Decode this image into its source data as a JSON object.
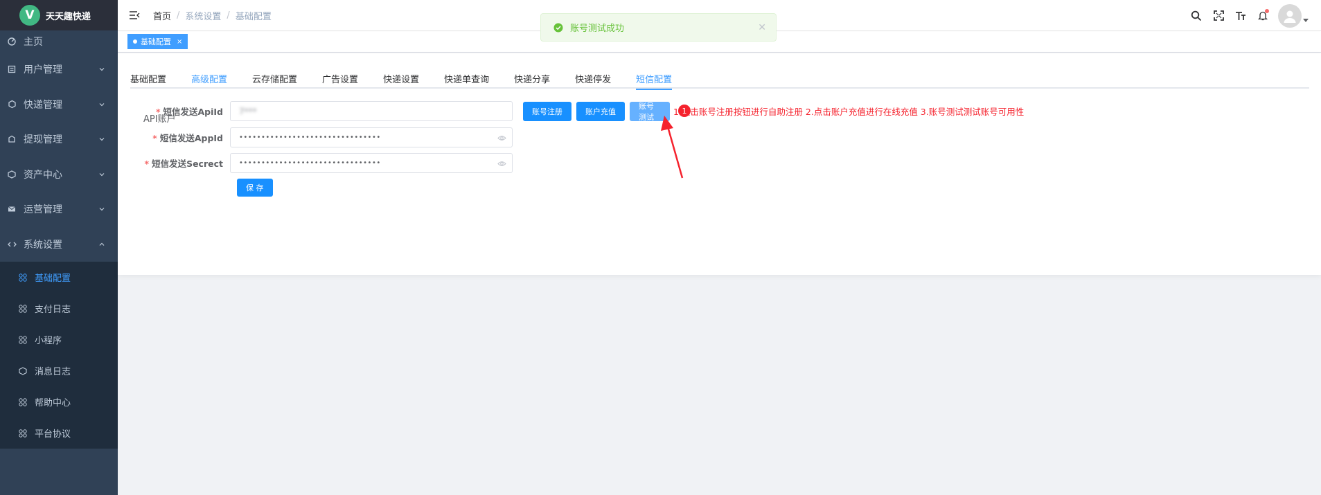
{
  "app": {
    "name": "天天趣快递",
    "logo_letter": "V"
  },
  "sidebar": {
    "items": [
      {
        "label": "主页",
        "icon": "dashboard-icon"
      },
      {
        "label": "用户管理",
        "icon": "user-icon"
      },
      {
        "label": "快递管理",
        "icon": "express-icon"
      },
      {
        "label": "提现管理",
        "icon": "withdraw-icon"
      },
      {
        "label": "资产中心",
        "icon": "asset-icon"
      },
      {
        "label": "运营管理",
        "icon": "mail-icon"
      },
      {
        "label": "系统设置",
        "icon": "code-icon"
      }
    ],
    "submenu": [
      {
        "label": "基础配置",
        "active": true
      },
      {
        "label": "支付日志"
      },
      {
        "label": "小程序"
      },
      {
        "label": "消息日志"
      },
      {
        "label": "帮助中心"
      },
      {
        "label": "平台协议"
      }
    ]
  },
  "breadcrumb": [
    "首页",
    "系统设置",
    "基础配置"
  ],
  "tags": {
    "active": "基础配置"
  },
  "toast": {
    "message": "账号测试成功"
  },
  "tabs": [
    "基础配置",
    "高级配置",
    "云存储配置",
    "广告设置",
    "快递设置",
    "快递单查询",
    "快递分享",
    "快递停发",
    "短信配置"
  ],
  "form": {
    "section_title": "API账户",
    "apiid_label": "短信发送ApiId",
    "apiid_value": "7***",
    "appid_label": "短信发送AppId",
    "appid_value": "••••••••••••••••••••••••••••••••",
    "secret_label": "短信发送Secrect",
    "secret_value": "••••••••••••••••••••••••••••••••",
    "register_btn": "账号注册",
    "recharge_btn": "账户充值",
    "test_btn": "账号测试",
    "hint": "1.点击账号注册按钮进行自助注册 2.点击账户充值进行在线充值 3.账号测试测试账号可用性",
    "save_btn": "保 存",
    "annotation_number": "1"
  },
  "colors": {
    "primary": "#1890ff",
    "sidebar": "#304156",
    "hint": "#f5222d",
    "success": "#67c23a"
  }
}
